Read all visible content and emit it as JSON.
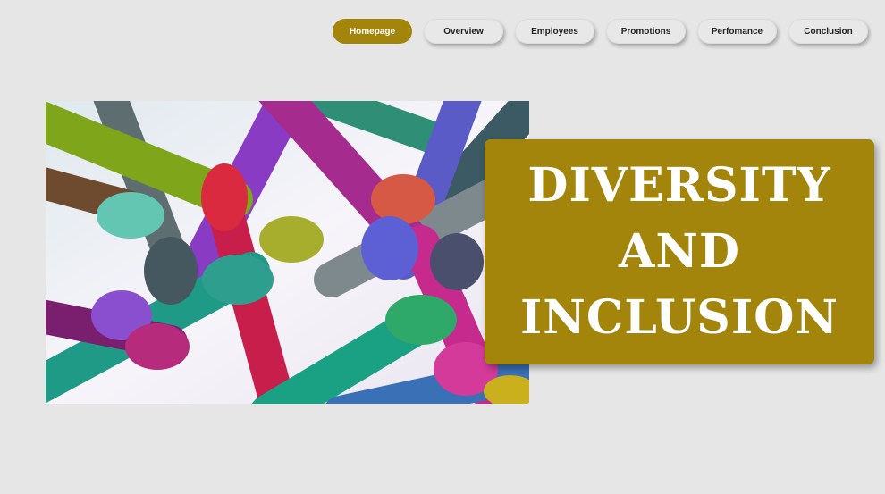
{
  "nav": {
    "items": [
      {
        "label": "Homepage",
        "active": true
      },
      {
        "label": "Overview",
        "active": false
      },
      {
        "label": "Employees",
        "active": false
      },
      {
        "label": "Promotions",
        "active": false
      },
      {
        "label": "Perfomance",
        "active": false
      },
      {
        "label": "Conclusion",
        "active": false
      }
    ]
  },
  "hero": {
    "title_lines": [
      "DIVERSITY",
      "AND",
      "INCLUSION"
    ]
  },
  "colors": {
    "accent": "#a3850b",
    "background": "#e6e6e6",
    "button_bg": "#e8e8e8"
  }
}
